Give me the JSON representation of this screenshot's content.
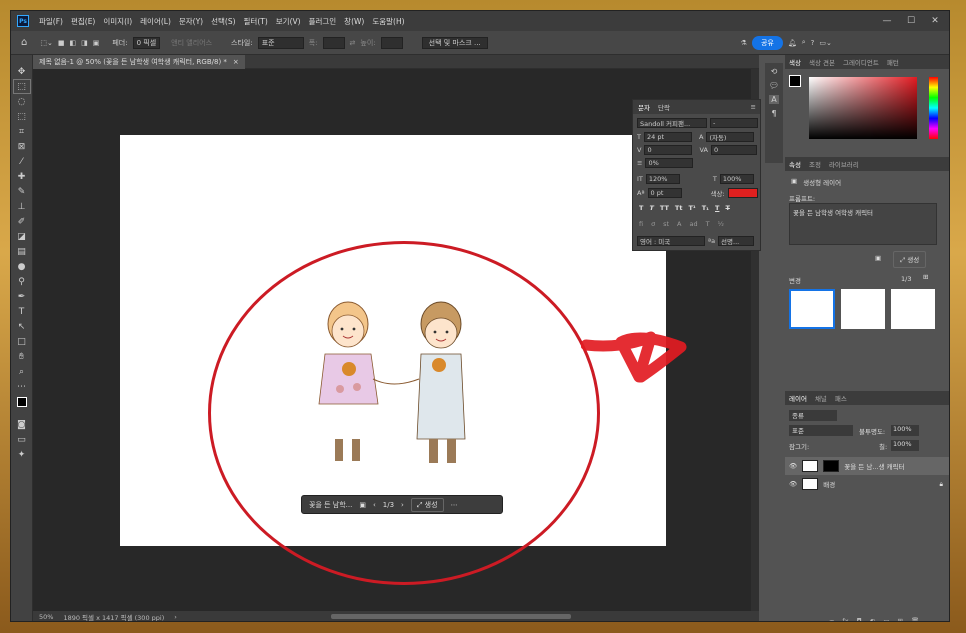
{
  "menu": {
    "logo": "Ps",
    "items": [
      "파일(F)",
      "편집(E)",
      "이미지(I)",
      "레이어(L)",
      "문자(Y)",
      "선택(S)",
      "필터(T)",
      "보기(V)",
      "플러그인",
      "창(W)",
      "도움말(H)"
    ]
  },
  "window_controls": {
    "minimize": "—",
    "maximize": "☐",
    "close": "✕"
  },
  "options": {
    "feather_label": "페더:",
    "feather_value": "0 픽셀",
    "antialias_label": "앤티 앨리어스",
    "style_label": "스타일:",
    "style_value": "표준",
    "width_label": "폭:",
    "height_label": "높이:",
    "select_mask_button": "선택 및 마스크 ...",
    "share_button": "공유"
  },
  "document": {
    "tab_title": "제목 없음-1 @ 50% (꽃을 든 남학생 여학생 캐릭터, RGB/8) *",
    "zoom": "50%",
    "info": "1890 픽셀 x 1417 픽셀 (300 ppi)"
  },
  "gen_bar": {
    "prompt": "꽃을 든 남학...",
    "page": "1/3",
    "generate_label": "생성"
  },
  "character_panel": {
    "tab_char": "문자",
    "tab_para": "단락",
    "font_family": "Sandoll 커피팬...",
    "font_style": "-",
    "size": "24 pt",
    "leading": "(자동)",
    "kerning": "0",
    "tracking": "0",
    "tsume": "0%",
    "vscale": "120%",
    "hscale": "100%",
    "baseline": "0 pt",
    "color_label": "색상:",
    "color": "#e0201f",
    "language": "영어 : 미국",
    "aa_mode": "선명..."
  },
  "color_panel": {
    "tabs": [
      "색상",
      "색상 견본",
      "그레이디언트",
      "패턴"
    ]
  },
  "properties_panel": {
    "tabs": [
      "속성",
      "조정",
      "라이브러리"
    ],
    "layer_type": "생성형 레이어",
    "prompt_label": "프롬프트:",
    "prompt_text": "꽃을 든 남학생 여학생 캐릭터",
    "generate_button": "생성",
    "variations_label": "변경",
    "variations_page": "1/3"
  },
  "layers_panel": {
    "tabs": [
      "레이어",
      "채널",
      "패스"
    ],
    "filter_label": "종류",
    "blend_mode": "표준",
    "opacity_label": "불투명도:",
    "opacity": "100%",
    "lock_label": "잠그기:",
    "fill_label": "칠:",
    "fill": "100%",
    "layers": [
      {
        "name": "꽃을 든 남...생 캐릭터"
      },
      {
        "name": "배경"
      }
    ]
  }
}
